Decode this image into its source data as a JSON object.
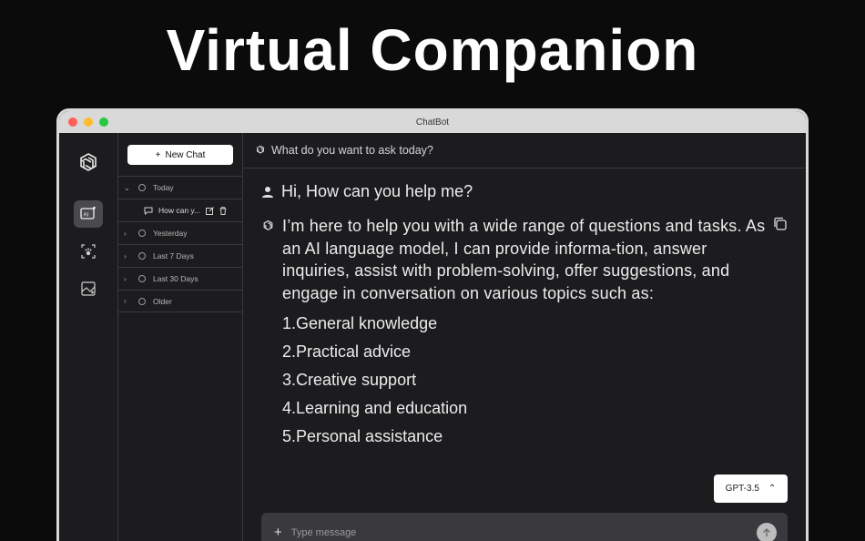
{
  "headline": "Virtual Companion",
  "window": {
    "title": "ChatBot"
  },
  "rail": {
    "items": [
      {
        "icon": "ai-chat-icon",
        "active": true
      },
      {
        "icon": "pet-scan-icon",
        "active": false
      },
      {
        "icon": "image-ai-icon",
        "active": false
      }
    ]
  },
  "sidebar": {
    "new_chat_label": "New Chat",
    "groups": {
      "today": "Today",
      "yesterday": "Yesterday",
      "last7": "Last 7 Days",
      "last30": "Last 30 Days",
      "older": "Older"
    },
    "today_chat": "How can y..."
  },
  "topbar": {
    "prompt": "What do you want to ask today?"
  },
  "conversation": {
    "user_message": "Hi, How can you help me?",
    "bot_intro": "I’m here to help you with a wide range of questions and tasks. As an AI language model, I can provide informa-tion, answer inquiries, assist with problem-solving, offer suggestions, and engage in conversation on various topics such as:",
    "bot_list": [
      "1.General knowledge",
      "2.Practical advice",
      "3.Creative support",
      "4.Learning and education",
      "5.Personal assistance"
    ]
  },
  "model_selector": {
    "label": "GPT-3.5"
  },
  "composer": {
    "placeholder": "Type message"
  },
  "colors": {
    "background": "#0b0b0b",
    "panel": "#1c1c1f",
    "composer": "#3a3a3e",
    "accent": "#ffffff"
  }
}
